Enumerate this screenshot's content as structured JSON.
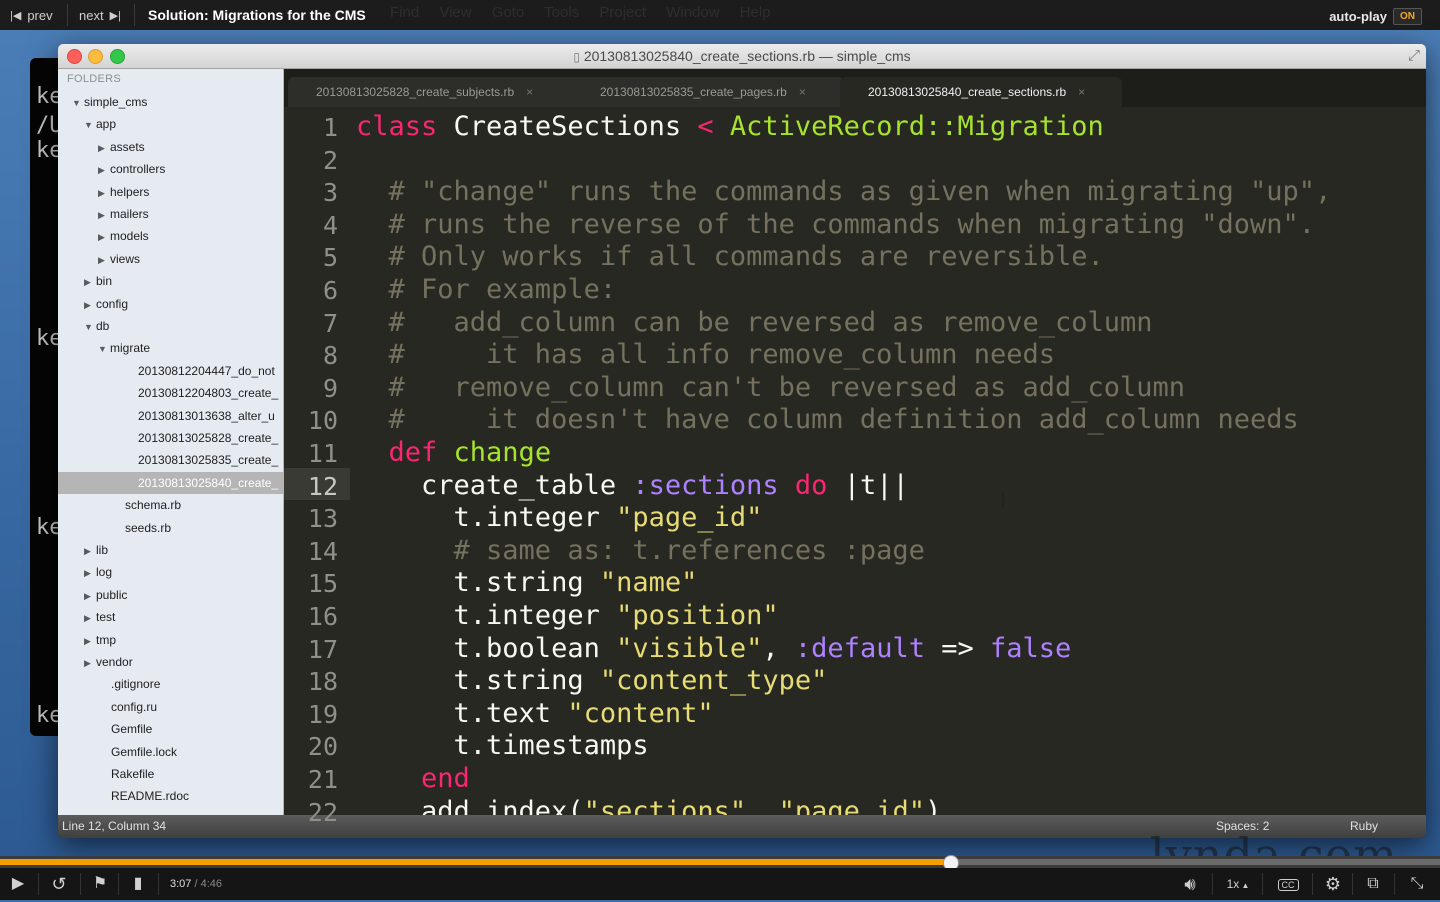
{
  "player": {
    "prev_label": "prev",
    "next_label": "next",
    "title": "Solution: Migrations for the CMS",
    "ghost_menu": "Find View Goto Tools Project Window Help",
    "autoplay_label": "auto-play",
    "autoplay_state": "ON",
    "time_current": "3:07",
    "time_total": "/ 4:46",
    "progress_fraction": 0.66,
    "speed_label": "1x",
    "cc_label": "CC",
    "watermark": "lynda.com"
  },
  "terminal": {
    "lines": [
      "ke",
      "/U",
      "ke",
      "ke",
      "ke",
      "ke"
    ]
  },
  "editor": {
    "window_title": "20130813025840_create_sections.rb — simple_cms",
    "sidebar": {
      "header": "FOLDERS",
      "items": [
        {
          "label": "simple_cms",
          "arrow": "▼"
        },
        {
          "label": "app",
          "arrow": "▼"
        },
        {
          "label": "assets",
          "arrow": "▶"
        },
        {
          "label": "controllers",
          "arrow": "▶"
        },
        {
          "label": "helpers",
          "arrow": "▶"
        },
        {
          "label": "mailers",
          "arrow": "▶"
        },
        {
          "label": "models",
          "arrow": "▶"
        },
        {
          "label": "views",
          "arrow": "▶"
        },
        {
          "label": "bin",
          "arrow": "▶"
        },
        {
          "label": "config",
          "arrow": "▶"
        },
        {
          "label": "db",
          "arrow": "▼"
        },
        {
          "label": "migrate",
          "arrow": "▼"
        },
        {
          "label": "20130812204447_do_not",
          "arrow": ""
        },
        {
          "label": "20130812204803_create_",
          "arrow": ""
        },
        {
          "label": "20130813013638_alter_u",
          "arrow": ""
        },
        {
          "label": "20130813025828_create_",
          "arrow": ""
        },
        {
          "label": "20130813025835_create_",
          "arrow": ""
        },
        {
          "label": "20130813025840_create_",
          "arrow": ""
        },
        {
          "label": "schema.rb",
          "arrow": ""
        },
        {
          "label": "seeds.rb",
          "arrow": ""
        },
        {
          "label": "lib",
          "arrow": "▶"
        },
        {
          "label": "log",
          "arrow": "▶"
        },
        {
          "label": "public",
          "arrow": "▶"
        },
        {
          "label": "test",
          "arrow": "▶"
        },
        {
          "label": "tmp",
          "arrow": "▶"
        },
        {
          "label": "vendor",
          "arrow": "▶"
        },
        {
          "label": ".gitignore",
          "arrow": ""
        },
        {
          "label": "config.ru",
          "arrow": ""
        },
        {
          "label": "Gemfile",
          "arrow": ""
        },
        {
          "label": "Gemfile.lock",
          "arrow": ""
        },
        {
          "label": "Rakefile",
          "arrow": ""
        },
        {
          "label": "README.rdoc",
          "arrow": ""
        }
      ]
    },
    "tabs": [
      {
        "label": "20130813025828_create_subjects.rb",
        "close": "×"
      },
      {
        "label": "20130813025835_create_pages.rb",
        "close": "×"
      },
      {
        "label": "20130813025840_create_sections.rb",
        "close": "×"
      }
    ],
    "line_numbers": [
      "1",
      "2",
      "3",
      "4",
      "5",
      "6",
      "7",
      "8",
      "9",
      "10",
      "11",
      "12",
      "13",
      "14",
      "15",
      "16",
      "17",
      "18",
      "19",
      "20",
      "21",
      "22"
    ],
    "code_lines": [
      [
        {
          "t": "class",
          "c": "kw"
        },
        {
          "t": " CreateSections ",
          "c": "cls"
        },
        {
          "t": "<",
          "c": "kw"
        },
        {
          "t": " ActiveRecord::Migration",
          "c": "inh"
        }
      ],
      [],
      [
        {
          "t": "  # \"change\" runs the commands as given when migrating \"up\",",
          "c": "cm"
        }
      ],
      [
        {
          "t": "  # runs the reverse of the commands when migrating \"down\".",
          "c": "cm"
        }
      ],
      [
        {
          "t": "  # Only works if all commands are reversible.",
          "c": "cm"
        }
      ],
      [
        {
          "t": "  # For example:",
          "c": "cm"
        }
      ],
      [
        {
          "t": "  #   add_column can be reversed as remove_column",
          "c": "cm"
        }
      ],
      [
        {
          "t": "  #     it has all info remove_column needs",
          "c": "cm"
        }
      ],
      [
        {
          "t": "  #   remove_column can't be reversed as add_column",
          "c": "cm"
        }
      ],
      [
        {
          "t": "  #     it doesn't have column definition add_column needs",
          "c": "cm"
        }
      ],
      [
        {
          "t": "  def",
          "c": "kw"
        },
        {
          "t": " change",
          "c": "fn"
        }
      ],
      [
        {
          "t": "    create_table ",
          "c": ""
        },
        {
          "t": ":sections",
          "c": "sym"
        },
        {
          "t": " do",
          "c": "kw"
        },
        {
          "t": " |t|",
          "c": ""
        }
      ],
      [
        {
          "t": "      t.integer ",
          "c": ""
        },
        {
          "t": "\"page_id\"",
          "c": "str"
        }
      ],
      [
        {
          "t": "      # same as: t.references :page",
          "c": "cm"
        }
      ],
      [
        {
          "t": "      t.string ",
          "c": ""
        },
        {
          "t": "\"name\"",
          "c": "str"
        }
      ],
      [
        {
          "t": "      t.integer ",
          "c": ""
        },
        {
          "t": "\"position\"",
          "c": "str"
        }
      ],
      [
        {
          "t": "      t.boolean ",
          "c": ""
        },
        {
          "t": "\"visible\"",
          "c": "str"
        },
        {
          "t": ", ",
          "c": ""
        },
        {
          "t": ":default",
          "c": "sym"
        },
        {
          "t": " => ",
          "c": ""
        },
        {
          "t": "false",
          "c": "sym"
        }
      ],
      [
        {
          "t": "      t.string ",
          "c": ""
        },
        {
          "t": "\"content_type\"",
          "c": "str"
        }
      ],
      [
        {
          "t": "      t.text ",
          "c": ""
        },
        {
          "t": "\"content\"",
          "c": "str"
        }
      ],
      [
        {
          "t": "      t.timestamps",
          "c": ""
        }
      ],
      [
        {
          "t": "    end",
          "c": "kw"
        }
      ],
      [
        {
          "t": "    add_index(",
          "c": ""
        },
        {
          "t": "\"sections\"",
          "c": "str"
        },
        {
          "t": ", ",
          "c": ""
        },
        {
          "t": "\"page_id\"",
          "c": "str"
        },
        {
          "t": ")",
          "c": ""
        }
      ]
    ],
    "status": {
      "position": "Line 12, Column 34",
      "spaces": "Spaces: 2",
      "syntax": "Ruby"
    }
  },
  "colors": {
    "editor_bg": "#272822",
    "keyword": "#f92672",
    "string": "#e6db74",
    "symbol": "#ae81ff",
    "comment": "#75715e",
    "progress": "#f5a000"
  }
}
